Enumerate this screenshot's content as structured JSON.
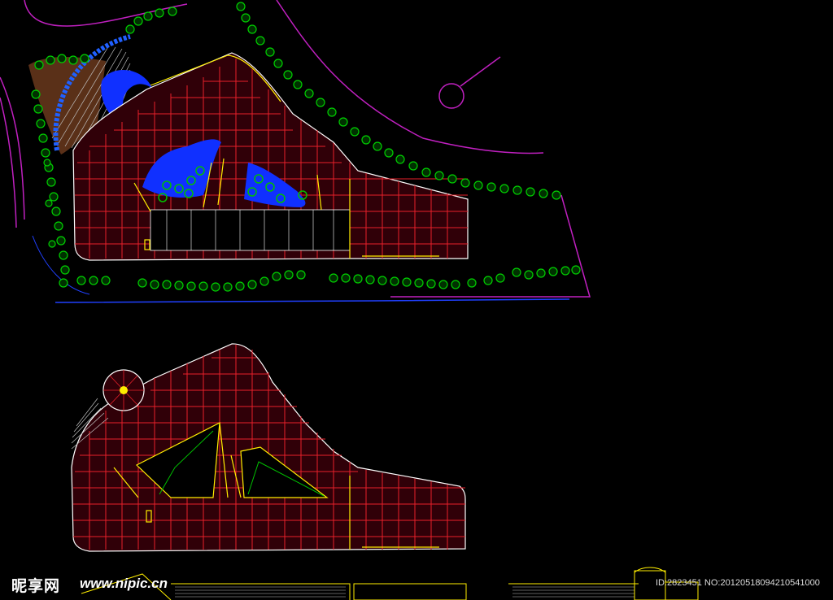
{
  "watermark": {
    "logo_text": "昵享网",
    "url_text": "www.nipic.cn",
    "id_text": "ID:2823451 NO:20120518094210541000"
  },
  "colors": {
    "background": "#000000",
    "grid_red": "#e8202a",
    "outline_white": "#ffffff",
    "accent_yellow": "#ffee00",
    "site_magenta": "#c020c0",
    "tree_green": "#00c000",
    "water_blue": "#1030ff",
    "road_blue": "#2040ff",
    "plaza_brown": "#6a3c20"
  },
  "drawings": [
    {
      "name": "site-plan-upper",
      "content": "landscape site plan with trees, water features and building footprint"
    },
    {
      "name": "floor-plan-lower",
      "content": "structural grid floor plan"
    },
    {
      "name": "elevation-strip",
      "content": "building elevation along bottom edge"
    }
  ]
}
